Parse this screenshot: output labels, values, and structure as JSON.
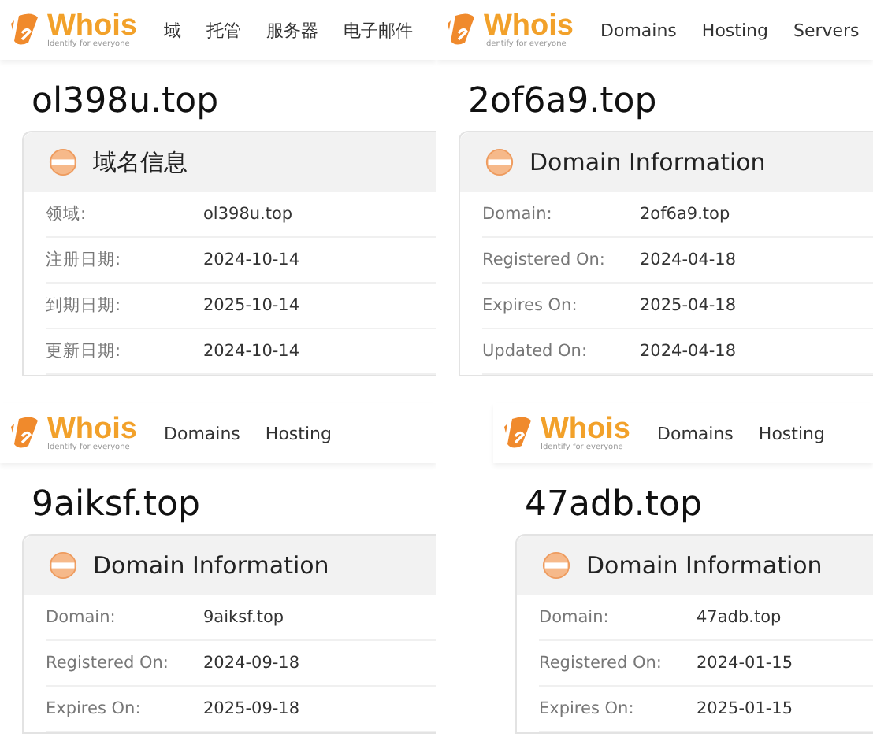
{
  "panels": [
    {
      "logo": {
        "name": "Whois",
        "tagline": "Identify for everyone"
      },
      "nav": [
        "域",
        "托管",
        "服务器",
        "电子邮件"
      ],
      "domain": "ol398u.top",
      "section_title": "域名信息",
      "rows": [
        {
          "label": "领域:",
          "value": "ol398u.top"
        },
        {
          "label": "注册日期:",
          "value": "2024-10-14"
        },
        {
          "label": "到期日期:",
          "value": "2025-10-14"
        },
        {
          "label": "更新日期:",
          "value": "2024-10-14"
        }
      ]
    },
    {
      "logo": {
        "name": "Whois",
        "tagline": "Identify for everyone"
      },
      "nav": [
        "Domains",
        "Hosting",
        "Servers"
      ],
      "domain": "2of6a9.top",
      "section_title": "Domain Information",
      "rows": [
        {
          "label": "Domain:",
          "value": "2of6a9.top"
        },
        {
          "label": "Registered On:",
          "value": "2024-04-18"
        },
        {
          "label": "Expires On:",
          "value": "2025-04-18"
        },
        {
          "label": "Updated On:",
          "value": "2024-04-18"
        }
      ]
    },
    {
      "logo": {
        "name": "Whois",
        "tagline": "Identify for everyone"
      },
      "nav": [
        "Domains",
        "Hosting"
      ],
      "domain": "9aiksf.top",
      "section_title": "Domain Information",
      "rows": [
        {
          "label": "Domain:",
          "value": "9aiksf.top"
        },
        {
          "label": "Registered On:",
          "value": "2024-09-18"
        },
        {
          "label": "Expires On:",
          "value": "2025-09-18"
        }
      ]
    },
    {
      "logo": {
        "name": "Whois",
        "tagline": "Identify for everyone"
      },
      "nav": [
        "Domains",
        "Hosting"
      ],
      "domain": "47adb.top",
      "section_title": "Domain Information",
      "rows": [
        {
          "label": "Domain:",
          "value": "47adb.top"
        },
        {
          "label": "Registered On:",
          "value": "2024-01-15"
        },
        {
          "label": "Expires On:",
          "value": "2025-01-15"
        }
      ]
    }
  ]
}
